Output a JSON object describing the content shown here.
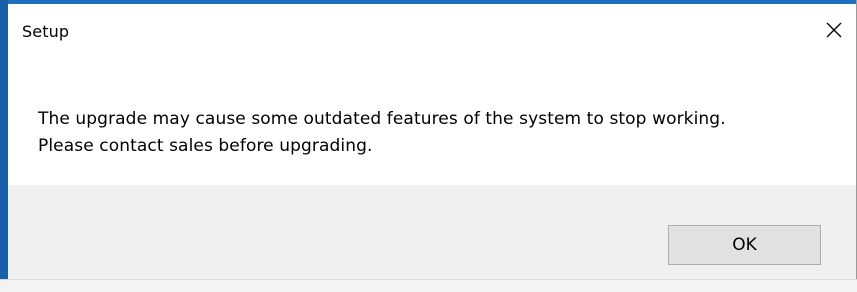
{
  "dialog": {
    "title": "Setup",
    "close_icon": "close-icon",
    "message_lines": [
      "The upgrade may cause some outdated features of the system to stop working.",
      "Please contact sales before upgrading."
    ],
    "ok_label": "OK"
  },
  "colors": {
    "window_border": "#1b5fa8",
    "dialog_background": "#ffffff",
    "button_bar_background": "#f0f0f0",
    "button_background": "#e1e1e1",
    "button_border": "#adadad"
  }
}
